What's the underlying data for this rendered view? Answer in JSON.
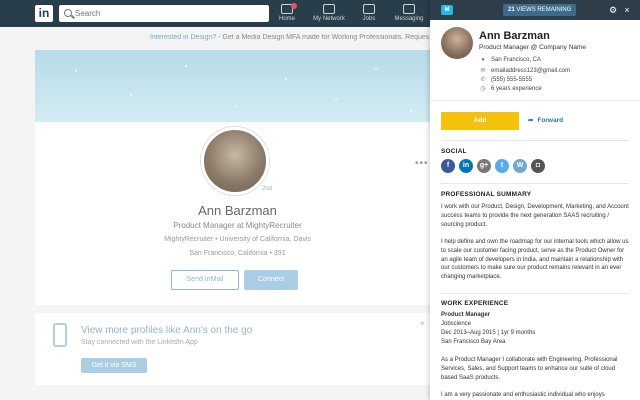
{
  "linkedin": {
    "logo": "in",
    "search_placeholder": "Search",
    "nav": [
      {
        "label": "Home",
        "icon": "home-icon"
      },
      {
        "label": "My Network",
        "icon": "network-icon"
      },
      {
        "label": "Jobs",
        "icon": "jobs-icon"
      },
      {
        "label": "Messaging",
        "icon": "messaging-icon"
      }
    ],
    "promo_link": "Interested in Design?",
    "promo_text": " - Get a Media Design MFA made for Working Professionals. Reques",
    "profile": {
      "degree": "2nd",
      "name": "Ann Barzman",
      "headline": "Product Manager at MightyRecruiter",
      "school": "MightyRecruiter • University of California, Davis",
      "location": "San Francisco, California • 391",
      "send_inmail": "Send InMail",
      "connect": "Connect",
      "more": "•••"
    },
    "app_promo": {
      "title": "View more profiles like Ann's on the go",
      "subtitle": "Stay connected with the LinkedIn App",
      "button": "Get it via SMS",
      "close": "×"
    }
  },
  "panel": {
    "logo": "M",
    "views_count": "21",
    "views_label": " VIEWS REMAINING",
    "gear": "⚙",
    "close": "×",
    "contact": {
      "name": "Ann Barzman",
      "title": "Product Manager @ Company Name",
      "location": "San Francisco, CA",
      "email": "emailaddress123@gmail.com",
      "phone": "(555) 555-5555",
      "experience": "6 years experience"
    },
    "add_label": "Add",
    "forward_label": "Forward",
    "social_heading": "SOCIAL",
    "social": [
      {
        "name": "facebook",
        "glyph": "f",
        "color": "#3b5998"
      },
      {
        "name": "linkedin",
        "glyph": "in",
        "color": "#0077b5"
      },
      {
        "name": "google-plus",
        "glyph": "g+",
        "color": "#777777"
      },
      {
        "name": "twitter",
        "glyph": "t",
        "color": "#55acee"
      },
      {
        "name": "wordpress",
        "glyph": "W",
        "color": "#6fa8d6"
      },
      {
        "name": "instagram",
        "glyph": "◘",
        "color": "#555555"
      }
    ],
    "summary_heading": "PROFESSIONAL SUMMARY",
    "summary_p1": "I work with our Product, Design, Development, Marketing, and Account success teams to provide the next generation SAAS recruiting / sourcing product.",
    "summary_p2": "I help define and own the roadmap for our internal tools which allow us to scale our customer facing product, serve as the Product Owner for an agile team of developers in India, and maintain a relationship with our customers to make sure our product remains relevant in an ever changing marketplace.",
    "work_heading": "WORK EXPERIENCE",
    "job": {
      "title": "Product Manager",
      "company": "Jobscience",
      "dates": "Dec 2013–Aug 2015 | 1yr 9 months",
      "location": "San Francisco Bay Area",
      "description": "As a Product Manager I collaborate with Engineering, Professional Services, Sales, and Support teams to enhance our suite of cloud based SaaS products.",
      "description2": "I am a very passionate and enthusiastic individual who enjoys"
    }
  }
}
